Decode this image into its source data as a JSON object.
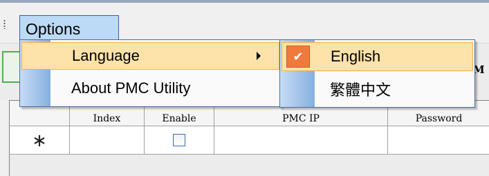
{
  "menubar": {
    "options_label": "Options"
  },
  "options_menu": {
    "items": [
      {
        "label": "Language",
        "has_submenu": true
      },
      {
        "label": "About PMC Utility"
      }
    ]
  },
  "language_submenu": {
    "items": [
      {
        "label": "English",
        "checked": true,
        "check_glyph": "✔"
      },
      {
        "label": "繁體中文",
        "checked": false
      }
    ]
  },
  "toolbar": {
    "partial_label": "M"
  },
  "grid": {
    "columns": [
      "Index",
      "Enable",
      "PMC IP",
      "Password"
    ],
    "new_row_marker": "∗"
  },
  "colors": {
    "highlight": "#fde2a9",
    "check_bg": "#f07a3c",
    "menu_active": "#bcd9f5"
  }
}
